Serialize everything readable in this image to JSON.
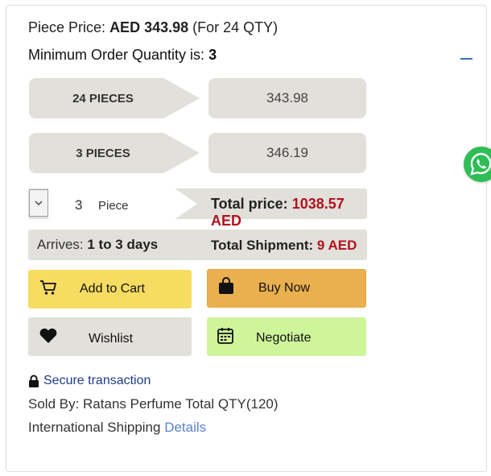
{
  "pricing": {
    "piece_price_label": "Piece Price:",
    "piece_price_value": "AED 343.98",
    "piece_price_note": "(For 24 QTY)",
    "moq_label": "Minimum Order Quantity is:",
    "moq_value": "3"
  },
  "tiers": [
    {
      "label": "24 PIECES",
      "price": "343.98"
    },
    {
      "label": "3 PIECES",
      "price": "346.19"
    }
  ],
  "quantity": {
    "value": "3",
    "unit": "Piece",
    "total_label": "Total price:",
    "total_value": "1038.57 AED"
  },
  "shipping": {
    "arrives_label": "Arrives:",
    "arrives_value": "1 to 3 days",
    "total_label": "Total Shipment:",
    "total_value": "9 AED"
  },
  "actions": {
    "add_to_cart": "Add to Cart",
    "buy_now": "Buy Now",
    "wishlist": "Wishlist",
    "negotiate": "Negotiate"
  },
  "info": {
    "secure": "Secure transaction",
    "sold_by": "Sold By: Ratans Perfume Total QTY(120)",
    "intl_shipping": "International Shipping",
    "details_link": "Details"
  },
  "colors": {
    "price_red": "#b0131e",
    "cart_yellow": "#f7dc62",
    "buy_orange": "#eab04f",
    "negotiate_green": "#cff59b",
    "tier_gray": "#e2e0da",
    "link_blue": "#5a82c8",
    "whatsapp_green": "#2fbd55"
  },
  "icons": {
    "cart": "cart-icon",
    "buy": "shopping-bag-icon",
    "wishlist": "heart-icon",
    "negotiate": "calendar-icon",
    "secure": "lock-icon",
    "chat": "whatsapp-icon",
    "select": "chevron-down-icon"
  }
}
